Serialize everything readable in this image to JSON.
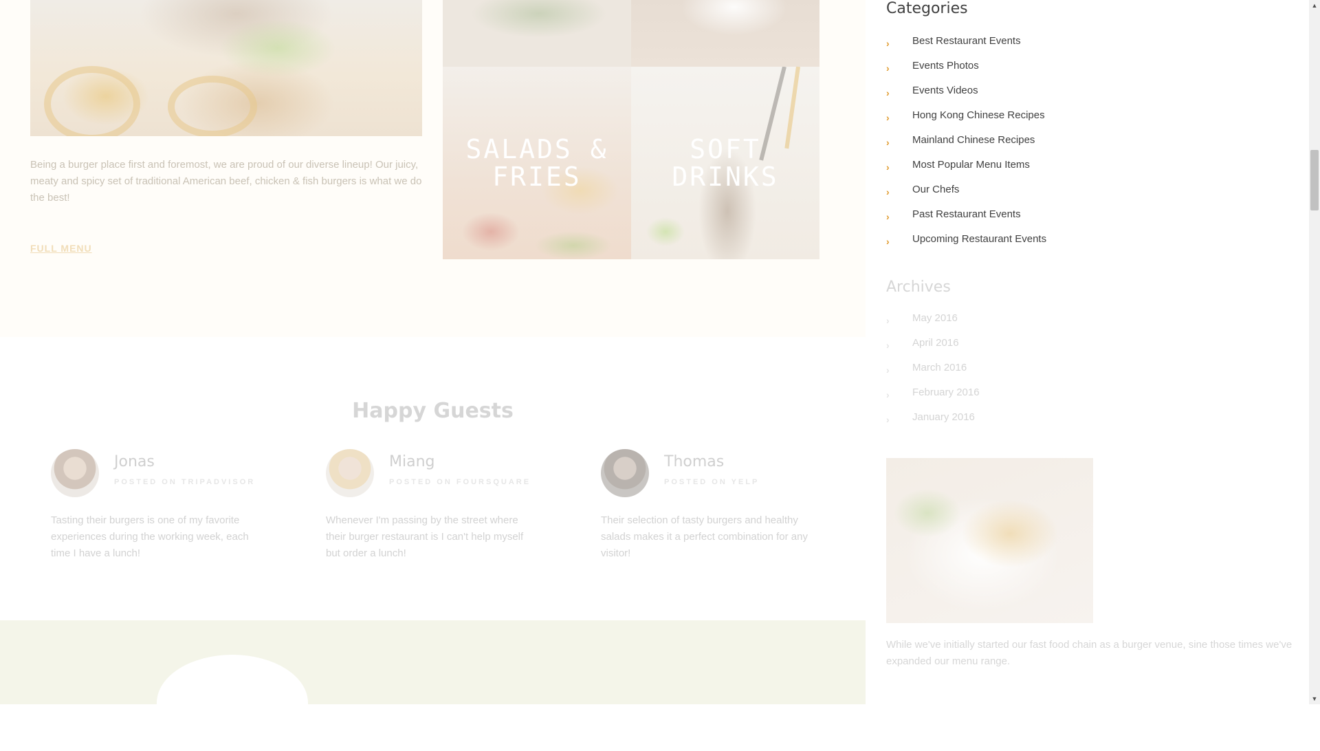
{
  "menu_section": {
    "description": "Being a burger place first and foremost, we are proud of our diverse lineup! Our juicy, meaty and spicy set of traditional American beef, chicken & fish burgers is what we do the best!",
    "full_menu_link": "FULL MENU",
    "tiles": [
      {
        "title": "SALADS &\nFRIES"
      },
      {
        "title": "SOFT\nDRINKS"
      }
    ]
  },
  "happy_guests": {
    "title": "Happy Guests",
    "guests": [
      {
        "name": "Jonas",
        "source": "POSTED ON TRIPADVISOR",
        "text": "Tasting their burgers is one of my favorite experiences during the working week, each time I have a lunch!"
      },
      {
        "name": "Miang",
        "source": "POSTED ON FOURSQUARE",
        "text": "Whenever I'm passing by the street where their burger restaurant is I can't help myself but order a lunch!"
      },
      {
        "name": "Thomas",
        "source": "POSTED ON YELP",
        "text": "Their selection of tasty burgers and healthy salads makes it a perfect combination for any visitor!"
      }
    ]
  },
  "sidebar": {
    "categories": {
      "title": "Categories",
      "items": [
        "Best Restaurant Events",
        "Events Photos",
        "Events Videos",
        "Hong Kong Chinese Recipes",
        "Mainland Chinese Recipes",
        "Most Popular Menu Items",
        "Our Chefs",
        "Past Restaurant Events",
        "Upcoming Restaurant Events"
      ]
    },
    "archives": {
      "title": "Archives",
      "items": [
        "May 2016",
        "April 2016",
        "March 2016",
        "February 2016",
        "January 2016"
      ]
    },
    "about_text": "While we've initially started our fast food chain as a burger venue, sine those times we've expanded our menu range."
  },
  "icons": {
    "list_bullet": "chevron-right-icon",
    "scroll_up": "arrow-up-icon",
    "scroll_down": "arrow-down-icon"
  },
  "colors": {
    "accent": "#e09a2c",
    "menu_bg": "#fffdf9",
    "green_bg": "#f4f5e9",
    "category_text": "#3f3f3f"
  }
}
